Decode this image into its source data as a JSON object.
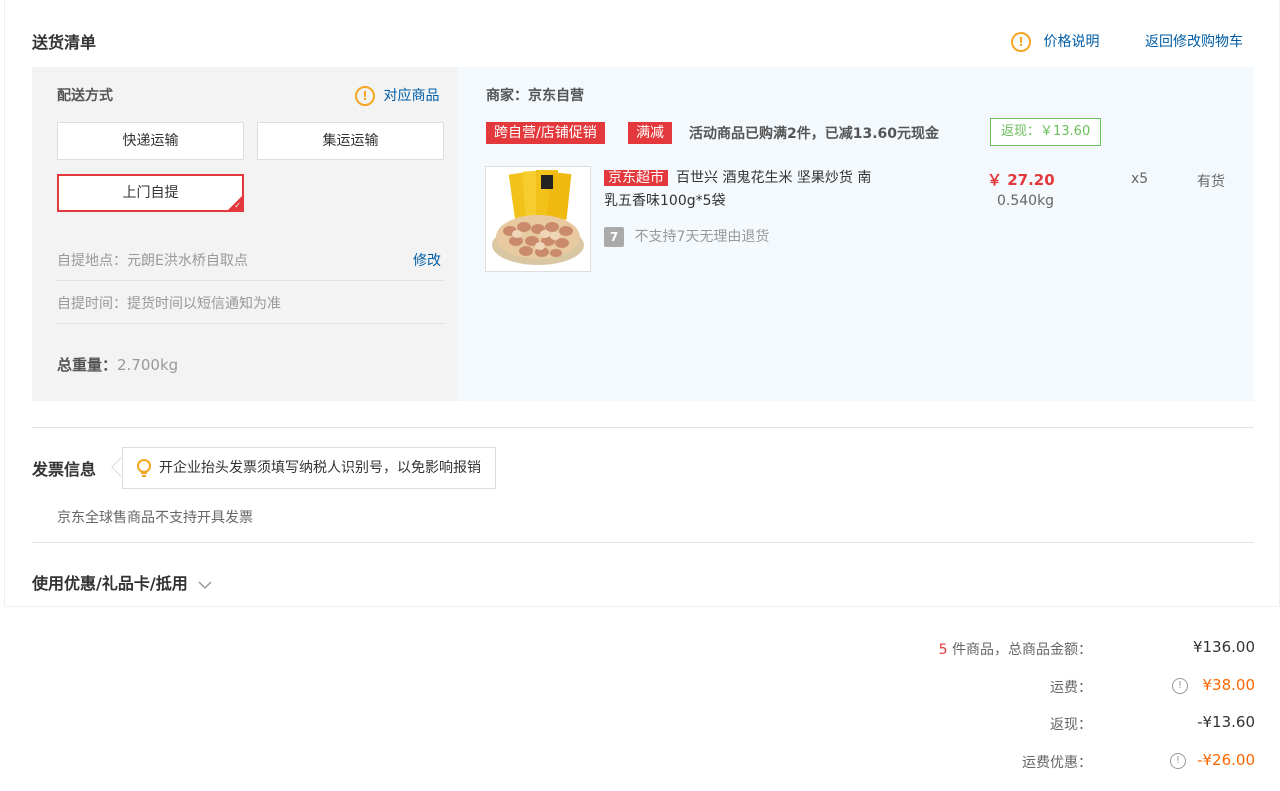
{
  "delivery": {
    "title": "送货清单",
    "price_note": "价格说明",
    "back_to_cart": "返回修改购物车",
    "method_label": "配送方式",
    "related_goods": "对应商品",
    "options": [
      "快递运输",
      "集运运输",
      "上门自提"
    ],
    "selected_option": "上门自提",
    "pickup_location_label": "自提地点：",
    "pickup_location": "元朗E洪水桥自取点",
    "modify": "修改",
    "pickup_time_label": "自提时间：",
    "pickup_time": "提货时间以短信通知为准",
    "total_weight_label": "总重量：",
    "total_weight": "2.700kg"
  },
  "merchant": {
    "label": "商家：",
    "name": "京东自营",
    "promo_tag": "跨自营/店铺促销",
    "discount_tag": "满减",
    "promo_text": "活动商品已购满2件，已减13.60元现金",
    "rebate": "返现：￥13.60"
  },
  "product": {
    "badge": "京东超市",
    "name_line1": "百世兴 酒鬼花生米 坚果炒货 南",
    "name_line2": "乳五香味100g*5袋",
    "no_return_icon": "7",
    "no_return_text": "不支持7天无理由退货",
    "price": "￥ 27.20",
    "weight": "0.540kg",
    "quantity": "x5",
    "stock": "有货"
  },
  "invoice": {
    "title": "发票信息",
    "tip": "开企业抬头发票须填写纳税人识别号，以免影响报销",
    "note": "京东全球售商品不支持开具发票"
  },
  "coupon": {
    "title": "使用优惠/礼品卡/抵用"
  },
  "summary": {
    "count": "5",
    "count_label": " 件商品，总商品金额：",
    "total": "¥136.00",
    "shipping_label": "运费：",
    "shipping": "¥38.00",
    "rebate_label": "返现：",
    "rebate": "-¥13.60",
    "shipping_discount_label": "运费优惠：",
    "shipping_discount": "-¥26.00"
  },
  "colors": {
    "accent_red": "#e4393c",
    "link_blue": "#005ea7",
    "orange": "#ff6600",
    "green": "#6bbf5a"
  }
}
